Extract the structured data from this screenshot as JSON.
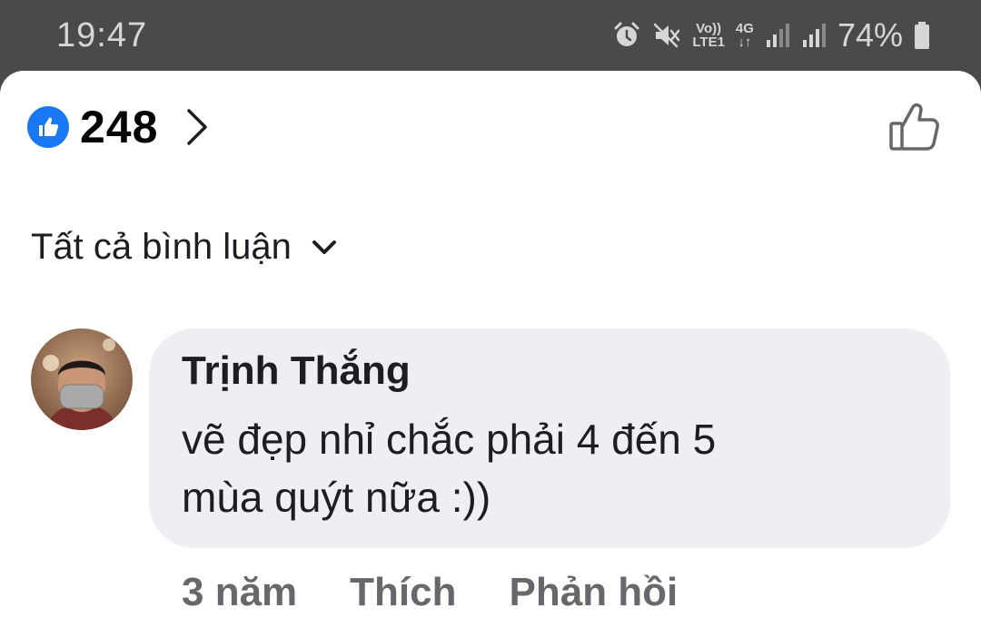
{
  "status_bar": {
    "time": "19:47",
    "volte_top": "Vo))",
    "volte_bottom": "LTE1",
    "network": "4G",
    "battery": "74%"
  },
  "reactions": {
    "count": "248",
    "icon": "like-thumb-icon"
  },
  "comments_filter": {
    "label": "Tất cả bình luận"
  },
  "comment": {
    "author": "Trịnh Thắng",
    "line1": "vẽ đẹp nhỉ chắc phải 4 đến 5",
    "line2": "mùa quýt nữa :))",
    "time": "3 năm",
    "like_action": "Thích",
    "reply_action": "Phản hồi"
  },
  "colors": {
    "accent": "#1877f2",
    "bubble": "#eeeff3",
    "meta_text": "#67686c"
  }
}
